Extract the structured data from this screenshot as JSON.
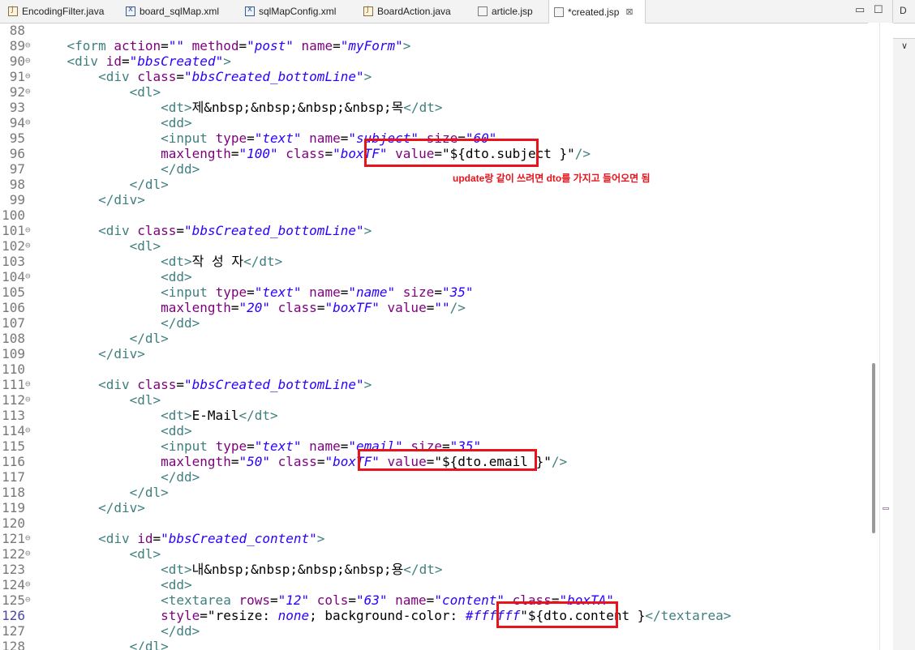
{
  "tabs": [
    {
      "label": "EncodingFilter.java",
      "icon": "java-file-icon"
    },
    {
      "label": "board_sqlMap.xml",
      "icon": "xml-file-icon"
    },
    {
      "label": "sqlMapConfig.xml",
      "icon": "xml-file-icon"
    },
    {
      "label": "BoardAction.java",
      "icon": "java-file-icon"
    },
    {
      "label": "article.jsp",
      "icon": "jsp-file-icon"
    },
    {
      "label": "*created.jsp",
      "icon": "jsp-file-icon",
      "active": true,
      "close": "⊠"
    }
  ],
  "window_controls": {
    "minimize": "▭",
    "maximize": "☐"
  },
  "side_panel": {
    "title": "D",
    "chevron": "∨"
  },
  "annotation": "update랑 같이 쓰려면 dto를 가지고 들어오면 됨",
  "editor": {
    "lines": [
      {
        "n": "88",
        "fold": "",
        "segs": []
      },
      {
        "n": "89",
        "fold": "⊖",
        "segs": [
          [
            "x",
            "    "
          ],
          [
            "t",
            "<form "
          ],
          [
            "a",
            "action"
          ],
          [
            "x",
            "="
          ],
          [
            "v",
            "\"\""
          ],
          [
            "x",
            " "
          ],
          [
            "a",
            "method"
          ],
          [
            "x",
            "="
          ],
          [
            "v",
            "\"post\""
          ],
          [
            "x",
            " "
          ],
          [
            "a",
            "name"
          ],
          [
            "x",
            "="
          ],
          [
            "v",
            "\"myForm\""
          ],
          [
            "t",
            ">"
          ]
        ]
      },
      {
        "n": "90",
        "fold": "⊖",
        "segs": [
          [
            "x",
            "    "
          ],
          [
            "t",
            "<div "
          ],
          [
            "a",
            "id"
          ],
          [
            "x",
            "="
          ],
          [
            "v",
            "\"bbsCreated\""
          ],
          [
            "t",
            ">"
          ]
        ]
      },
      {
        "n": "91",
        "fold": "⊖",
        "segs": [
          [
            "x",
            "        "
          ],
          [
            "t",
            "<div "
          ],
          [
            "a",
            "class"
          ],
          [
            "x",
            "="
          ],
          [
            "v",
            "\"bbsCreated_bottomLine\""
          ],
          [
            "t",
            ">"
          ]
        ]
      },
      {
        "n": "92",
        "fold": "⊖",
        "segs": [
          [
            "x",
            "            "
          ],
          [
            "t",
            "<dl>"
          ]
        ]
      },
      {
        "n": "93",
        "fold": "",
        "segs": [
          [
            "x",
            "                "
          ],
          [
            "t",
            "<dt>"
          ],
          [
            "x",
            "제&nbsp;&nbsp;&nbsp;&nbsp;목"
          ],
          [
            "t",
            "</dt>"
          ]
        ]
      },
      {
        "n": "94",
        "fold": "⊖",
        "segs": [
          [
            "x",
            "                "
          ],
          [
            "t",
            "<dd>"
          ]
        ]
      },
      {
        "n": "95",
        "fold": "",
        "segs": [
          [
            "x",
            "                "
          ],
          [
            "t",
            "<input "
          ],
          [
            "a",
            "type"
          ],
          [
            "x",
            "="
          ],
          [
            "v",
            "\"text\""
          ],
          [
            "x",
            " "
          ],
          [
            "a",
            "name"
          ],
          [
            "x",
            "="
          ],
          [
            "v",
            "\"subject\""
          ],
          [
            "x",
            " "
          ],
          [
            "a",
            "size"
          ],
          [
            "x",
            "="
          ],
          [
            "v",
            "\"60\""
          ]
        ]
      },
      {
        "n": "96",
        "fold": "",
        "segs": [
          [
            "x",
            "                "
          ],
          [
            "a",
            "maxlength"
          ],
          [
            "x",
            "="
          ],
          [
            "v",
            "\"100\""
          ],
          [
            "x",
            " "
          ],
          [
            "a",
            "class"
          ],
          [
            "x",
            "="
          ],
          [
            "v",
            "\"boxTF\""
          ],
          [
            "x",
            " "
          ],
          [
            "a",
            "value"
          ],
          [
            "x",
            "=\"${dto.subject }\""
          ],
          [
            "t",
            "/>"
          ]
        ]
      },
      {
        "n": "97",
        "fold": "",
        "segs": [
          [
            "x",
            "                "
          ],
          [
            "t",
            "</dd>"
          ]
        ]
      },
      {
        "n": "98",
        "fold": "",
        "segs": [
          [
            "x",
            "            "
          ],
          [
            "t",
            "</dl>"
          ]
        ]
      },
      {
        "n": "99",
        "fold": "",
        "segs": [
          [
            "x",
            "        "
          ],
          [
            "t",
            "</div>"
          ]
        ]
      },
      {
        "n": "100",
        "fold": "",
        "segs": []
      },
      {
        "n": "101",
        "fold": "⊖",
        "segs": [
          [
            "x",
            "        "
          ],
          [
            "t",
            "<div "
          ],
          [
            "a",
            "class"
          ],
          [
            "x",
            "="
          ],
          [
            "v",
            "\"bbsCreated_bottomLine\""
          ],
          [
            "t",
            ">"
          ]
        ]
      },
      {
        "n": "102",
        "fold": "⊖",
        "segs": [
          [
            "x",
            "            "
          ],
          [
            "t",
            "<dl>"
          ]
        ]
      },
      {
        "n": "103",
        "fold": "",
        "segs": [
          [
            "x",
            "                "
          ],
          [
            "t",
            "<dt>"
          ],
          [
            "x",
            "작 성 자"
          ],
          [
            "t",
            "</dt>"
          ]
        ]
      },
      {
        "n": "104",
        "fold": "⊖",
        "segs": [
          [
            "x",
            "                "
          ],
          [
            "t",
            "<dd>"
          ]
        ]
      },
      {
        "n": "105",
        "fold": "",
        "segs": [
          [
            "x",
            "                "
          ],
          [
            "t",
            "<input "
          ],
          [
            "a",
            "type"
          ],
          [
            "x",
            "="
          ],
          [
            "v",
            "\"text\""
          ],
          [
            "x",
            " "
          ],
          [
            "a",
            "name"
          ],
          [
            "x",
            "="
          ],
          [
            "v",
            "\"name\""
          ],
          [
            "x",
            " "
          ],
          [
            "a",
            "size"
          ],
          [
            "x",
            "="
          ],
          [
            "v",
            "\"35\""
          ]
        ]
      },
      {
        "n": "106",
        "fold": "",
        "segs": [
          [
            "x",
            "                "
          ],
          [
            "a",
            "maxlength"
          ],
          [
            "x",
            "="
          ],
          [
            "v",
            "\"20\""
          ],
          [
            "x",
            " "
          ],
          [
            "a",
            "class"
          ],
          [
            "x",
            "="
          ],
          [
            "v",
            "\"boxTF\""
          ],
          [
            "x",
            " "
          ],
          [
            "a",
            "value"
          ],
          [
            "x",
            "="
          ],
          [
            "v",
            "\"\""
          ],
          [
            "t",
            "/>"
          ]
        ]
      },
      {
        "n": "107",
        "fold": "",
        "segs": [
          [
            "x",
            "                "
          ],
          [
            "t",
            "</dd>"
          ]
        ]
      },
      {
        "n": "108",
        "fold": "",
        "segs": [
          [
            "x",
            "            "
          ],
          [
            "t",
            "</dl>"
          ]
        ]
      },
      {
        "n": "109",
        "fold": "",
        "segs": [
          [
            "x",
            "        "
          ],
          [
            "t",
            "</div>"
          ]
        ]
      },
      {
        "n": "110",
        "fold": "",
        "segs": []
      },
      {
        "n": "111",
        "fold": "⊖",
        "segs": [
          [
            "x",
            "        "
          ],
          [
            "t",
            "<div "
          ],
          [
            "a",
            "class"
          ],
          [
            "x",
            "="
          ],
          [
            "v",
            "\"bbsCreated_bottomLine\""
          ],
          [
            "t",
            ">"
          ]
        ]
      },
      {
        "n": "112",
        "fold": "⊖",
        "segs": [
          [
            "x",
            "            "
          ],
          [
            "t",
            "<dl>"
          ]
        ]
      },
      {
        "n": "113",
        "fold": "",
        "segs": [
          [
            "x",
            "                "
          ],
          [
            "t",
            "<dt>"
          ],
          [
            "x",
            "E-Mail"
          ],
          [
            "t",
            "</dt>"
          ]
        ]
      },
      {
        "n": "114",
        "fold": "⊖",
        "segs": [
          [
            "x",
            "                "
          ],
          [
            "t",
            "<dd>"
          ]
        ]
      },
      {
        "n": "115",
        "fold": "",
        "segs": [
          [
            "x",
            "                "
          ],
          [
            "t",
            "<input "
          ],
          [
            "a",
            "type"
          ],
          [
            "x",
            "="
          ],
          [
            "v",
            "\"text\""
          ],
          [
            "x",
            " "
          ],
          [
            "a",
            "name"
          ],
          [
            "x",
            "="
          ],
          [
            "v",
            "\"email\""
          ],
          [
            "x",
            " "
          ],
          [
            "a",
            "size"
          ],
          [
            "x",
            "="
          ],
          [
            "v",
            "\"35\""
          ]
        ]
      },
      {
        "n": "116",
        "fold": "",
        "segs": [
          [
            "x",
            "                "
          ],
          [
            "a",
            "maxlength"
          ],
          [
            "x",
            "="
          ],
          [
            "v",
            "\"50\""
          ],
          [
            "x",
            " "
          ],
          [
            "a",
            "class"
          ],
          [
            "x",
            "="
          ],
          [
            "v",
            "\"boxTF\""
          ],
          [
            "x",
            " "
          ],
          [
            "a",
            "value"
          ],
          [
            "x",
            "=\"${dto.email }\""
          ],
          [
            "t",
            "/>"
          ]
        ]
      },
      {
        "n": "117",
        "fold": "",
        "segs": [
          [
            "x",
            "                "
          ],
          [
            "t",
            "</dd>"
          ]
        ]
      },
      {
        "n": "118",
        "fold": "",
        "segs": [
          [
            "x",
            "            "
          ],
          [
            "t",
            "</dl>"
          ]
        ]
      },
      {
        "n": "119",
        "fold": "",
        "segs": [
          [
            "x",
            "        "
          ],
          [
            "t",
            "</div>"
          ]
        ]
      },
      {
        "n": "120",
        "fold": "",
        "segs": []
      },
      {
        "n": "121",
        "fold": "⊖",
        "segs": [
          [
            "x",
            "        "
          ],
          [
            "t",
            "<div "
          ],
          [
            "a",
            "id"
          ],
          [
            "x",
            "="
          ],
          [
            "v",
            "\"bbsCreated_content\""
          ],
          [
            "t",
            ">"
          ]
        ]
      },
      {
        "n": "122",
        "fold": "⊖",
        "segs": [
          [
            "x",
            "            "
          ],
          [
            "t",
            "<dl>"
          ]
        ]
      },
      {
        "n": "123",
        "fold": "",
        "segs": [
          [
            "x",
            "                "
          ],
          [
            "t",
            "<dt>"
          ],
          [
            "x",
            "내&nbsp;&nbsp;&nbsp;&nbsp;용"
          ],
          [
            "t",
            "</dt>"
          ]
        ]
      },
      {
        "n": "124",
        "fold": "⊖",
        "segs": [
          [
            "x",
            "                "
          ],
          [
            "t",
            "<dd>"
          ]
        ]
      },
      {
        "n": "125",
        "fold": "⊖",
        "segs": [
          [
            "x",
            "                "
          ],
          [
            "t",
            "<textarea "
          ],
          [
            "a",
            "rows"
          ],
          [
            "x",
            "="
          ],
          [
            "v",
            "\"12\""
          ],
          [
            "x",
            " "
          ],
          [
            "a",
            "cols"
          ],
          [
            "x",
            "="
          ],
          [
            "v",
            "\"63\""
          ],
          [
            "x",
            " "
          ],
          [
            "a",
            "name"
          ],
          [
            "x",
            "="
          ],
          [
            "v",
            "\"content\""
          ],
          [
            "x",
            " "
          ],
          [
            "a",
            "class"
          ],
          [
            "x",
            "="
          ],
          [
            "v",
            "\"boxTA\""
          ]
        ]
      },
      {
        "n": "126",
        "fold": "",
        "current": true,
        "segs": [
          [
            "x",
            "                "
          ],
          [
            "a",
            "style"
          ],
          [
            "x",
            "=\"resize: "
          ],
          [
            "v",
            "none"
          ],
          [
            "x",
            "; background-color: "
          ],
          [
            "v",
            "#ffffff"
          ],
          [
            "x",
            "\"${dto.content }"
          ],
          [
            "t",
            "</textarea>"
          ]
        ]
      },
      {
        "n": "127",
        "fold": "",
        "segs": [
          [
            "x",
            "                "
          ],
          [
            "t",
            "</dd>"
          ]
        ]
      },
      {
        "n": "128",
        "fold": "",
        "segs": [
          [
            "x",
            "            "
          ],
          [
            "t",
            "</dl>"
          ]
        ]
      }
    ]
  }
}
